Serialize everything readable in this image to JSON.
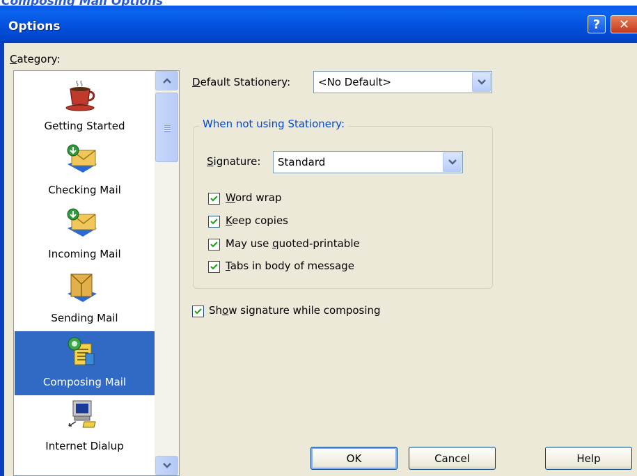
{
  "background_title": "Composing Mail Options",
  "dialog": {
    "title": "Options",
    "help_glyph": "?",
    "close_glyph": "✕"
  },
  "category": {
    "label_accel": "C",
    "label_rest": "ategory:",
    "items": [
      {
        "label": "Getting Started",
        "icon": "coffee-cup-icon",
        "selected": false
      },
      {
        "label": "Checking Mail",
        "icon": "check-mail-icon",
        "selected": false
      },
      {
        "label": "Incoming Mail",
        "icon": "incoming-mail-icon",
        "selected": false
      },
      {
        "label": "Sending Mail",
        "icon": "sending-mail-icon",
        "selected": false
      },
      {
        "label": "Composing Mail",
        "icon": "composing-mail-icon",
        "selected": true
      },
      {
        "label": "Internet Dialup",
        "icon": "internet-dialup-icon",
        "selected": false
      }
    ]
  },
  "stationery": {
    "label_accel": "D",
    "label_rest": "efault Stationery:",
    "value": "<No Default>"
  },
  "group": {
    "title": "When not using Stationery:",
    "signature": {
      "label_accel": "S",
      "label_rest": "ignature:",
      "value": "Standard"
    },
    "options": [
      {
        "pre": "",
        "accel": "W",
        "post": "ord wrap",
        "checked": true
      },
      {
        "pre": "",
        "accel": "K",
        "post": "eep copies",
        "checked": true
      },
      {
        "pre": "May use ",
        "accel": "q",
        "post": "uoted-printable",
        "checked": true
      },
      {
        "pre": "",
        "accel": "T",
        "post": "abs in body of message",
        "checked": true
      }
    ]
  },
  "show_signature": {
    "pre": "Sh",
    "accel": "o",
    "post": "w signature while composing",
    "checked": true
  },
  "buttons": {
    "ok": "OK",
    "cancel": "Cancel",
    "help": "Help"
  },
  "colors": {
    "title_bar": "#0352de",
    "selection": "#316ac5",
    "group_title": "#0046d5",
    "dialog_face": "#ece9d8"
  }
}
